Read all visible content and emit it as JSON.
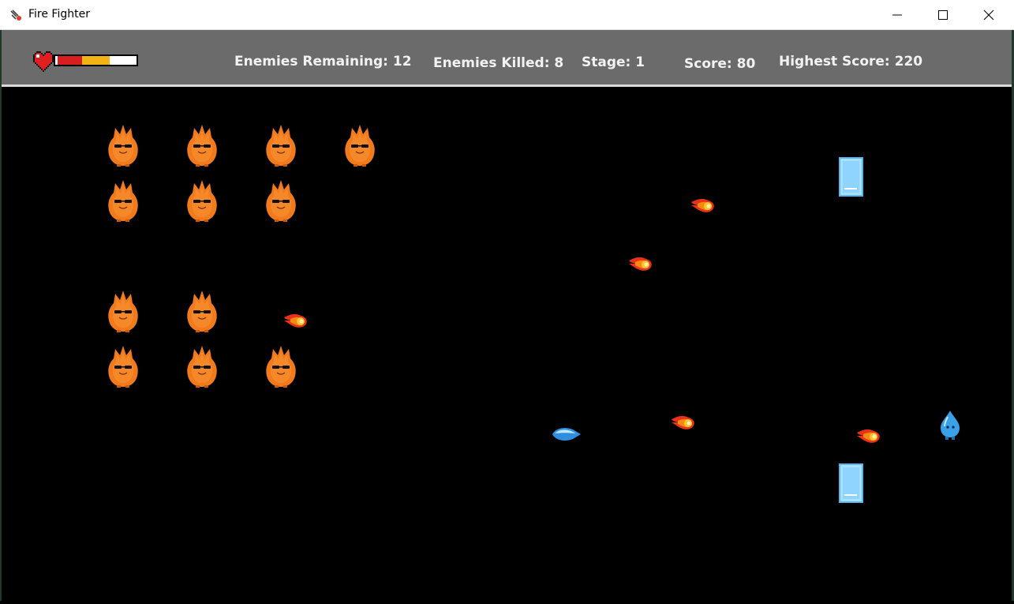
{
  "window": {
    "title": "Fire Fighter"
  },
  "hud": {
    "health_fraction": 0.7,
    "enemies_remaining": "Enemies Remaining: 12",
    "enemies_killed": "Enemies Killed: 8",
    "stage": "Stage: 1",
    "score": "Score: 80",
    "highest_score": "Highest Score: 220"
  },
  "colors": {
    "hud_background": "#6b6b6b",
    "health_red": "#d81e1e",
    "health_yellow": "#f4b315",
    "flame_enemy": "#f07a1c",
    "ice_block": "#8fd3ff",
    "player_water": "#3aa0e8"
  },
  "entities": {
    "fire_enemy_count": 12,
    "fireball_count": 5,
    "ice_barrier_count": 2,
    "water_projectile_count": 1,
    "player_icon": "water-drop-icon"
  }
}
